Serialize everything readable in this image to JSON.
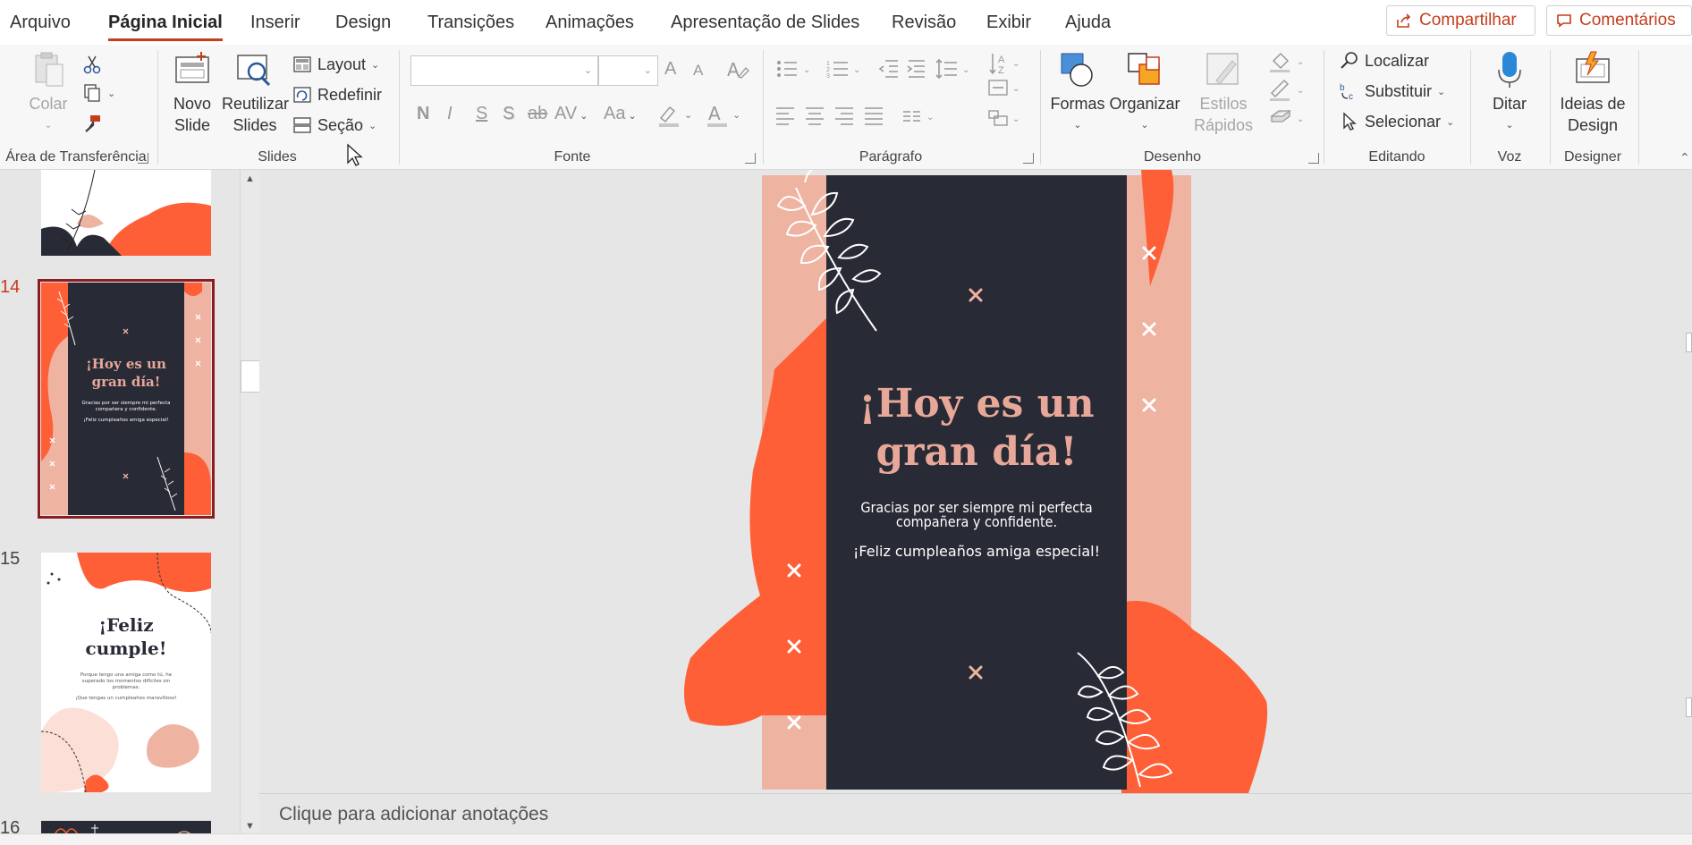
{
  "menu": {
    "tabs": [
      "Arquivo",
      "Página Inicial",
      "Inserir",
      "Design",
      "Transições",
      "Animações",
      "Apresentação de Slides",
      "Revisão",
      "Exibir",
      "Ajuda"
    ],
    "share_label": "Compartilhar",
    "comments_label": "Comentários"
  },
  "ribbon": {
    "clipboard": {
      "paste_label": "Colar",
      "group_label": "Área de Transferência"
    },
    "slides": {
      "new_slide_label": "Novo Slide",
      "reuse_slides_label": "Reutilizar Slides",
      "layout_label": "Layout",
      "reset_label": "Redefinir",
      "section_label": "Seção",
      "group_label": "Slides"
    },
    "font": {
      "bold": "N",
      "italic": "I",
      "underline": "S",
      "shadow": "S",
      "strike": "ab",
      "spacing": "AV",
      "case": "Aa",
      "font_color_glyph": "A",
      "grow": "A",
      "shrink": "A",
      "group_label": "Fonte"
    },
    "paragraph": {
      "group_label": "Parágrafo"
    },
    "drawing": {
      "shapes_label": "Formas",
      "arrange_label": "Organizar",
      "quick_styles_label": "Estilos Rápidos",
      "group_label": "Desenho"
    },
    "editing": {
      "find_label": "Localizar",
      "replace_label": "Substituir",
      "select_label": "Selecionar",
      "group_label": "Editando"
    },
    "voice": {
      "dictate_label": "Ditar",
      "group_label": "Voz"
    },
    "designer": {
      "ideas_label": "Ideias de Design",
      "group_label": "Designer"
    }
  },
  "thumbnails": {
    "items": [
      {
        "number": "14",
        "title": "¡Hoy es un gran día!",
        "body": "Gracias por ser siempre mi perfecta compañera y confidente.",
        "body2": "¡Feliz cumpleaños amiga especial!"
      },
      {
        "number": "15",
        "title": "¡Feliz cumple!",
        "body": "Porque tengo una amiga como tú, he superado los momentos difíciles sin problemas.",
        "body2": "¡Que tengas un cumpleaños maravilloso!"
      },
      {
        "number": "16"
      }
    ]
  },
  "slide": {
    "title": "¡Hoy es un gran día!",
    "body_line1": "Gracias por ser siempre mi perfecta",
    "body_line2": "compañera y confidente.",
    "body2": "¡Feliz cumpleaños amiga especial!",
    "colors": {
      "dark": "#282a35",
      "orange": "#fe5f37",
      "peach": "#eeb3a1",
      "title": "#e8a899"
    }
  },
  "notes": {
    "placeholder": "Clique para adicionar anotações"
  }
}
